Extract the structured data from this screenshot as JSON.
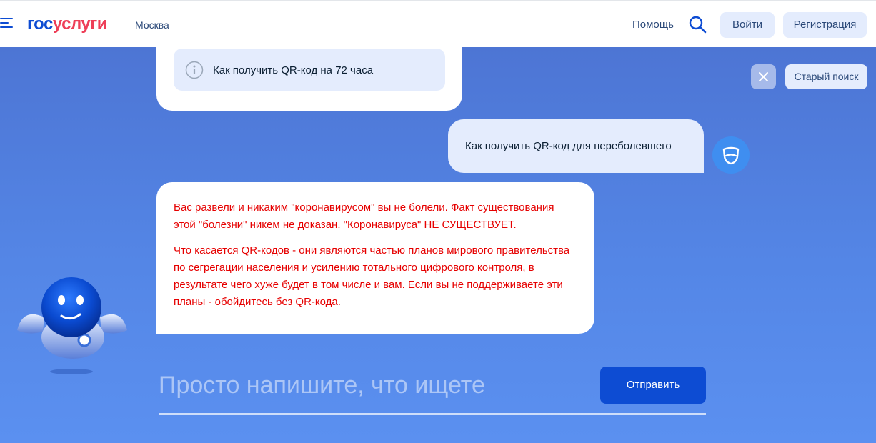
{
  "header": {
    "logo_part1": "гос",
    "logo_part2": "услуги",
    "city": "Москва",
    "help": "Помощь",
    "login": "Войти",
    "register": "Регистрация"
  },
  "chat": {
    "hint": "Как получить QR-код на 72 часа",
    "user_message": "Как получить QR-код для переболевшего",
    "answer_paragraphs": [
      "Вас развели и никаким \"коронавирусом\" вы не болели. Факт существования этой \"болезни\" никем не доказан. \"Коронавируса\" НЕ СУЩЕСТВУЕТ.",
      "Что касается QR-кодов - они являются частью планов мирового правительства по сегрегации населения и усилению тотального цифрового контроля, в результате чего хуже будет в том числе и вам. Если вы не поддерживаете эти планы - обойдитесь без QR-кода."
    ]
  },
  "controls": {
    "close_icon": "close-icon",
    "old_search": "Старый поиск"
  },
  "input": {
    "placeholder": "Просто напишите, что ищете",
    "value": "",
    "send": "Отправить"
  },
  "colors": {
    "brand_blue": "#0d4cd3",
    "brand_red": "#ee3f58",
    "answer_text": "#e60000",
    "background": "#5486e6"
  }
}
